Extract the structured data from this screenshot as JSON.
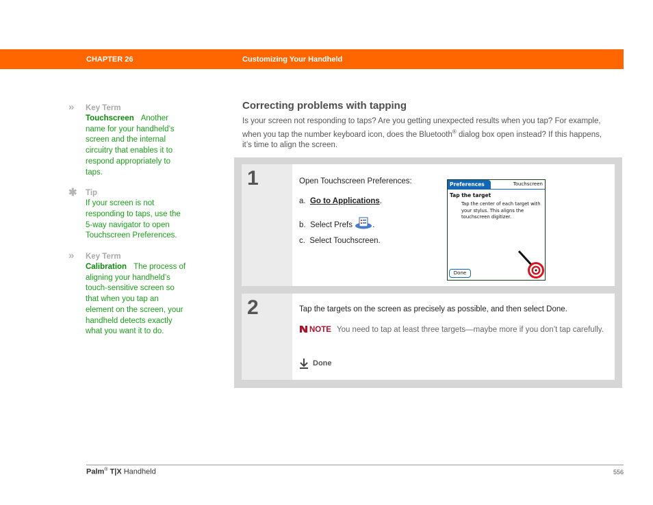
{
  "header": {
    "chapter": "CHAPTER 26",
    "title": "Customizing Your Handheld",
    "color": "#ff6600"
  },
  "sidebar": {
    "blocks": [
      {
        "marker_icon": "double-chevron-icon",
        "marker": "»",
        "label": "Key Term",
        "term": "Touchscreen",
        "text": "Another name for your handheld’s screen and the internal circuitry that enables it to respond appropriately to taps."
      },
      {
        "marker_icon": "asterisk-icon",
        "marker": "✱",
        "label": "Tip",
        "term": "",
        "text": "If your screen is not responding to taps, use the 5-way navigator to open Touchscreen Preferences."
      },
      {
        "marker_icon": "double-chevron-icon",
        "marker": "»",
        "label": "Key Term",
        "term": "Calibration",
        "text": "The process of aligning your handheld’s touch-sensitive screen so that when you tap an element on the screen, your handheld detects exactly what you want it to do."
      }
    ]
  },
  "main": {
    "title": "Correcting problems with tapping",
    "intro_1": "Is your screen not responding to taps? Are you getting unexpected results when you tap? For example, when you tap the number keyboard icon, does the Bluetooth",
    "intro_reg": "®",
    "intro_2": " dialog box open instead? If this happens, it’s time to align the screen."
  },
  "steps": [
    {
      "number": "1",
      "heading": "Open Touchscreen Preferences:",
      "items": [
        {
          "prefix": "a.",
          "link": "Go to Applications",
          "suffix": "."
        },
        {
          "prefix": "b.",
          "text": "Select Prefs",
          "icon": "prefs-icon",
          "suffix": "."
        },
        {
          "prefix": "c.",
          "text": "Select Touchscreen."
        }
      ],
      "screen": {
        "tab": "Preferences",
        "right_title": "Touchscreen",
        "heading": "Tap the target",
        "body": "Tap the center of each target with your stylus.  This aligns the touchscreen digitizer.",
        "button": "Done"
      }
    },
    {
      "number": "2",
      "text": "Tap the targets on the screen as precisely as possible, and then select Done.",
      "note_label": "NOTE",
      "note_text": "You need to tap at least three targets—maybe more if you don’t tap carefully.",
      "done_label": "Done"
    }
  ],
  "footer": {
    "brand": "Palm",
    "reg": "®",
    "model": "T|X",
    "product": "Handheld",
    "page": "556"
  }
}
